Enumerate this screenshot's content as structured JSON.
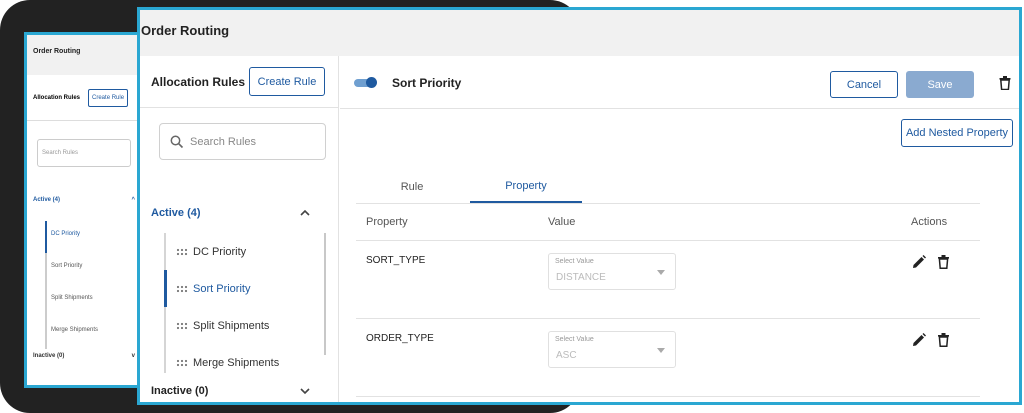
{
  "background_app": {
    "header_title": "Order Routing",
    "rules_title": "Allocation Rules",
    "create_label": "Create Rule",
    "search_placeholder": "Search Rules",
    "active_label": "Active (4)",
    "items": [
      {
        "label": "DC Priority"
      },
      {
        "label": "Sort Priority"
      },
      {
        "label": "Split Shipments"
      },
      {
        "label": "Merge Shipments"
      }
    ],
    "inactive_label": "Inactive (0)"
  },
  "app": {
    "header_title": "Order Routing"
  },
  "sidebar": {
    "title": "Allocation Rules",
    "create_button": "Create Rule",
    "search_placeholder": "Search Rules",
    "active_group": "Active (4)",
    "rules": [
      {
        "label": "DC Priority",
        "selected": false
      },
      {
        "label": "Sort Priority",
        "selected": true
      },
      {
        "label": "Split Shipments",
        "selected": false
      },
      {
        "label": "Merge Shipments",
        "selected": false
      }
    ],
    "inactive_group": "Inactive (0)"
  },
  "main": {
    "rule_name": "Sort Priority",
    "enabled": true,
    "cancel_label": "Cancel",
    "save_label": "Save",
    "add_nested_label": "Add Nested Property",
    "tabs": [
      {
        "label": "Rule",
        "active": false
      },
      {
        "label": "Property",
        "active": true
      }
    ],
    "table": {
      "columns": [
        "Property",
        "Value",
        "Actions"
      ],
      "rows": [
        {
          "property": "SORT_TYPE",
          "select_label": "Select Value",
          "value": "DISTANCE"
        },
        {
          "property": "ORDER_TYPE",
          "select_label": "Select Value",
          "value": "ASC"
        }
      ]
    }
  },
  "colors": {
    "accent": "#1f5aa0",
    "frame": "#2aa7d2",
    "save_disabled": "#8aaad0",
    "header_bg": "#f1f1f1"
  }
}
